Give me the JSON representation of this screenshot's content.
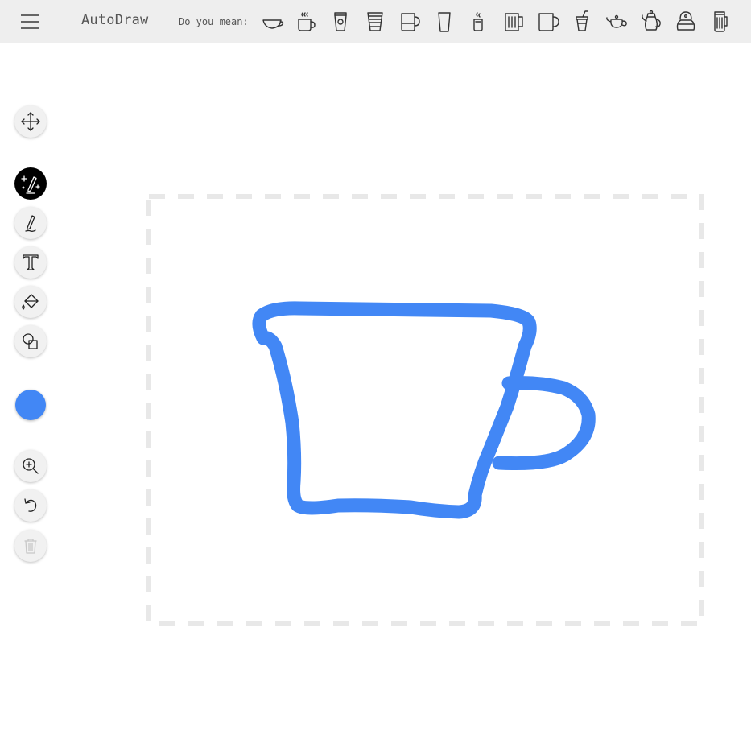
{
  "app": {
    "title": "AutoDraw"
  },
  "suggestions": {
    "label": "Do you mean:",
    "items": [
      {
        "icon": "teacup-icon"
      },
      {
        "icon": "steaming-mug-icon"
      },
      {
        "icon": "takeaway-coffee-cup-icon"
      },
      {
        "icon": "striped-cup-icon"
      },
      {
        "icon": "mug-icon"
      },
      {
        "icon": "glass-icon"
      },
      {
        "icon": "small-steaming-cup-icon"
      },
      {
        "icon": "beer-mug-icon"
      },
      {
        "icon": "coffee-mug-icon"
      },
      {
        "icon": "lidded-cup-with-straw-icon"
      },
      {
        "icon": "teapot-icon"
      },
      {
        "icon": "tall-teapot-icon"
      },
      {
        "icon": "kettle-icon"
      },
      {
        "icon": "tankard-icon"
      }
    ]
  },
  "toolbar": {
    "tools": [
      {
        "icon": "move-icon",
        "state": "normal"
      },
      {
        "icon": "autodraw-icon",
        "state": "active"
      },
      {
        "icon": "pencil-icon",
        "state": "normal"
      },
      {
        "icon": "text-icon",
        "state": "normal"
      },
      {
        "icon": "fill-icon",
        "state": "normal"
      },
      {
        "icon": "shape-icon",
        "state": "normal"
      },
      {
        "icon": "zoom-in-icon",
        "state": "normal"
      },
      {
        "icon": "undo-icon",
        "state": "normal"
      },
      {
        "icon": "trash-icon",
        "state": "disabled"
      }
    ]
  },
  "colors": {
    "current": "#4287f5",
    "topbar_bg": "#eeeeee",
    "selection_border": "#e8e8e8"
  }
}
